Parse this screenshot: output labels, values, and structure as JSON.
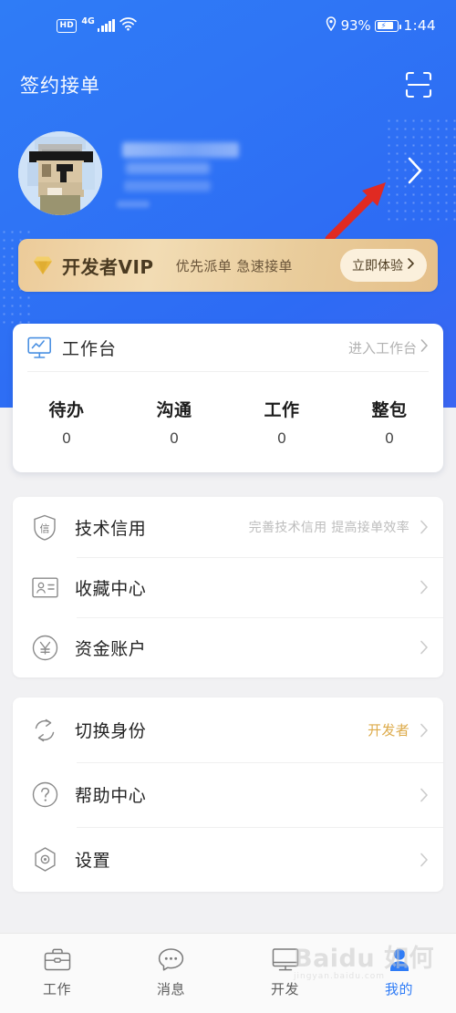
{
  "statusbar": {
    "hd_label": "HD",
    "network_label": "4G",
    "signal_icon": "signal-bars-icon",
    "wifi_icon": "wifi-icon",
    "location_icon": "location-pin-icon",
    "battery_percent": "93%",
    "battery_icon": "battery-charging-icon",
    "time": "1:44"
  },
  "header": {
    "title": "签约接单",
    "scan_icon": "scan-qr-icon",
    "profile_chevron_icon": "chevron-right-icon",
    "avatar_name": "avatar",
    "annotation_arrow": "red-annotation-arrow"
  },
  "vip_banner": {
    "diamond_icon": "diamond-icon",
    "title": "开发者VIP",
    "subtitle": "优先派单 急速接单",
    "button_label": "立即体验",
    "button_chevron_icon": "chevron-right-icon",
    "bg_color": "#eccb99"
  },
  "workbench": {
    "icon": "monitor-chart-icon",
    "title": "工作台",
    "enter_label": "进入工作台",
    "enter_chevron_icon": "chevron-right-icon",
    "stats": [
      {
        "label": "待办",
        "value": "0"
      },
      {
        "label": "沟通",
        "value": "0"
      },
      {
        "label": "工作",
        "value": "0"
      },
      {
        "label": "整包",
        "value": "0"
      }
    ]
  },
  "menu_group_1": [
    {
      "icon": "shield-credit-icon",
      "label": "技术信用",
      "value": "完善技术信用 提高接单效率",
      "chevron": "chevron-right-icon"
    },
    {
      "icon": "id-card-icon",
      "label": "收藏中心",
      "value": "",
      "chevron": "chevron-right-icon"
    },
    {
      "icon": "yen-circle-icon",
      "label": "资金账户",
      "value": "",
      "chevron": "chevron-right-icon"
    }
  ],
  "menu_group_2": [
    {
      "icon": "switch-refresh-icon",
      "label": "切换身份",
      "value": "开发者",
      "value_color": "#ddab4b",
      "chevron": "chevron-right-icon"
    },
    {
      "icon": "question-circle-icon",
      "label": "帮助中心",
      "value": "",
      "chevron": "chevron-right-icon"
    },
    {
      "icon": "settings-hexagon-icon",
      "label": "设置",
      "value": "",
      "chevron": "chevron-right-icon"
    }
  ],
  "bottom_nav": {
    "active_color": "#2f7cf6",
    "items": [
      {
        "icon": "briefcase-icon",
        "label": "工作",
        "active": false
      },
      {
        "icon": "chat-bubble-icon",
        "label": "消息",
        "active": false
      },
      {
        "icon": "monitor-icon",
        "label": "开发",
        "active": false
      },
      {
        "icon": "person-icon",
        "label": "我的",
        "active": true
      }
    ]
  },
  "watermark": {
    "text": "Baidu 如何",
    "subtext": "jingyan.baidu.com"
  }
}
